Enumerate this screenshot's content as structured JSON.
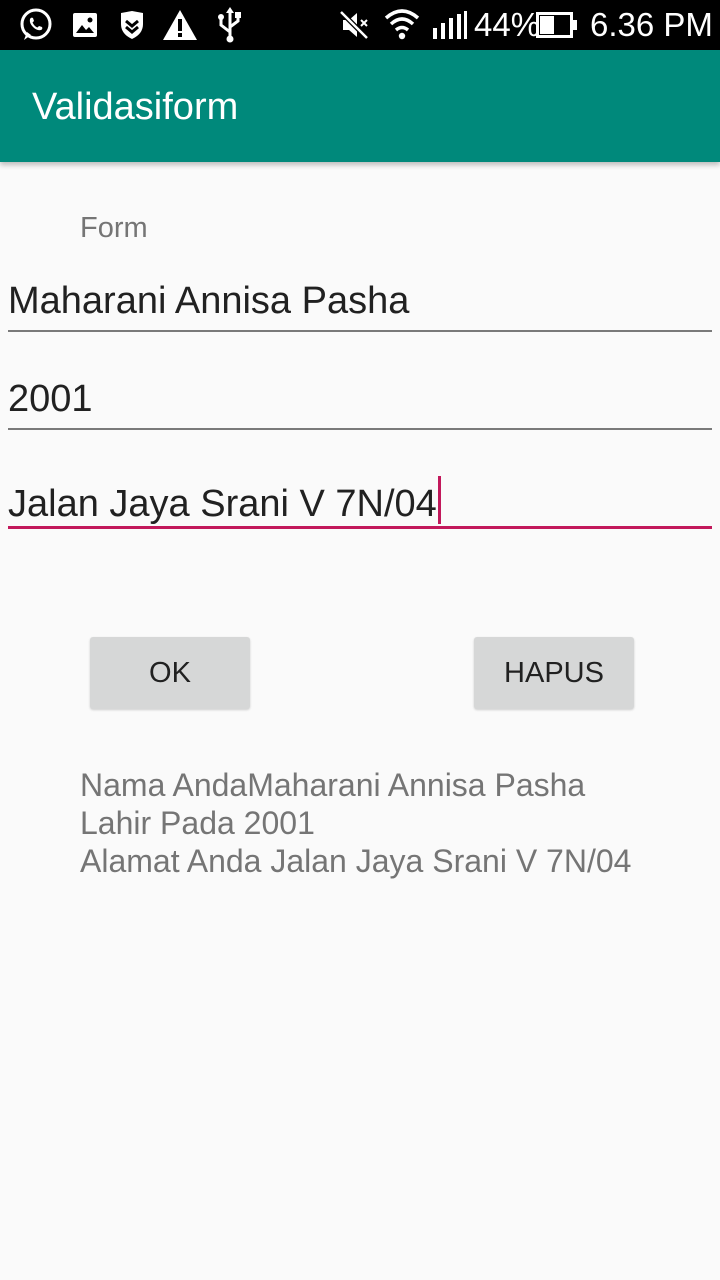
{
  "status_bar": {
    "battery_percent": "44%",
    "time": "6.36 PM",
    "icons": [
      "whatsapp-icon",
      "image-icon",
      "shield-icon",
      "warning-icon",
      "usb-icon",
      "mute-icon",
      "wifi-icon",
      "signal-icon",
      "battery-icon"
    ]
  },
  "app_bar": {
    "title": "Validasiform"
  },
  "form": {
    "label": "Form",
    "name_value": "Maharani Annisa Pasha",
    "year_value": "2001",
    "address_value": "Jalan Jaya Srani V 7N/04"
  },
  "buttons": {
    "ok_label": "OK",
    "clear_label": "HAPUS"
  },
  "result": {
    "line1": "Nama AndaMaharani Annisa Pasha",
    "line2": "Lahir Pada 2001",
    "line3": "Alamat Anda Jalan Jaya Srani V 7N/04"
  },
  "colors": {
    "primary": "#00897b",
    "accent": "#c2185b",
    "background": "#fafafa",
    "button": "#d6d7d7"
  }
}
